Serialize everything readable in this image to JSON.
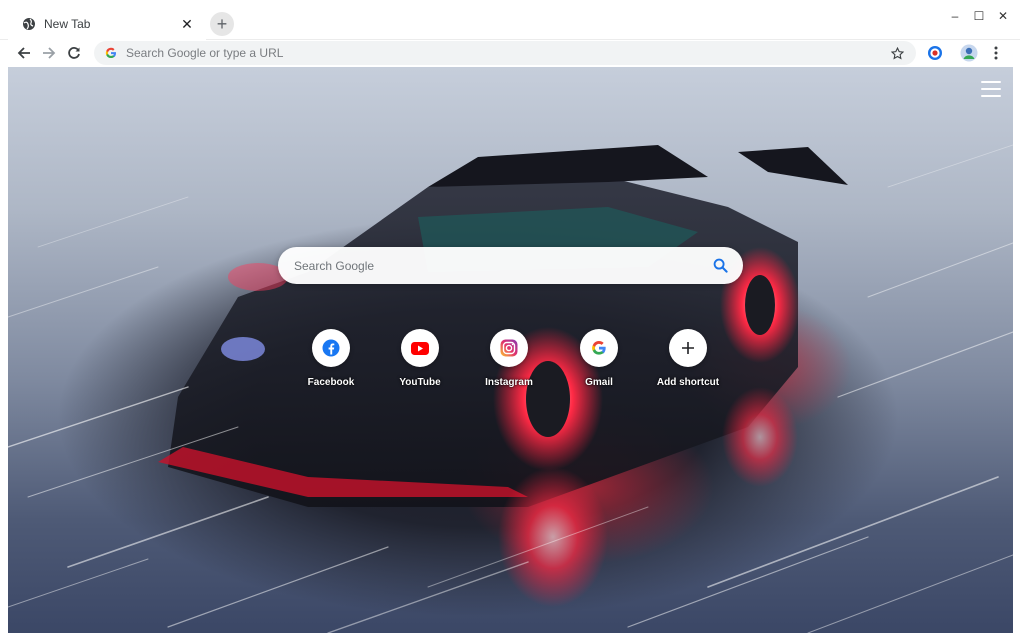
{
  "tab": {
    "title": "New Tab",
    "close_glyph": "✕"
  },
  "new_tab_glyph": "+",
  "window_controls": {
    "minimize": "–",
    "maximize": "☐",
    "close": "✕"
  },
  "omnibox": {
    "placeholder": "Search Google or type a URL"
  },
  "search": {
    "placeholder": "Search Google"
  },
  "shortcuts": [
    {
      "label": "Facebook",
      "icon": "facebook-icon",
      "color": "#1877f2"
    },
    {
      "label": "YouTube",
      "icon": "youtube-icon",
      "color": "#ff0000"
    },
    {
      "label": "Instagram",
      "icon": "instagram-icon",
      "color": "#d6249f"
    },
    {
      "label": "Gmail",
      "icon": "google-icon",
      "color": "#4285f4"
    },
    {
      "label": "Add shortcut",
      "icon": "plus-icon",
      "color": "#202124"
    }
  ],
  "colors": {
    "accent_blue": "#1a73e8",
    "omnibox_bg": "#f1f3f4"
  }
}
